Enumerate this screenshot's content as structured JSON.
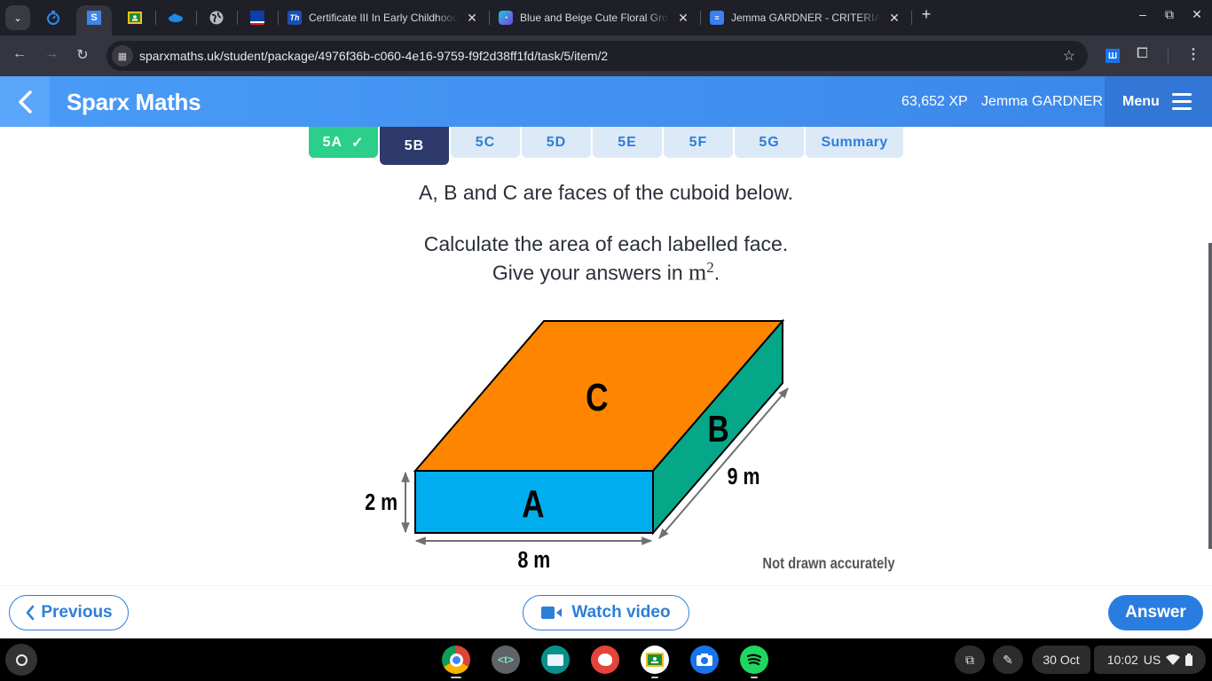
{
  "browser": {
    "tabs": [
      {
        "title": "Certificate III In Early Childhood",
        "favicon": "certificate-favicon",
        "color": "#1a4fb3"
      },
      {
        "title": "Blue and Beige Cute Floral Group",
        "favicon": "canva-favicon",
        "color": "#7b3fe4"
      },
      {
        "title": "Jemma GARDNER - CRITERIA -",
        "favicon": "docs-favicon",
        "color": "#3b7ff0"
      }
    ],
    "pinned_tabs": [
      "timer-icon",
      "sparx-s-icon",
      "classroom-icon",
      "onedrive-icon",
      "globe-icon",
      "flag-icon"
    ],
    "pinned_active_letter": "S",
    "new_tab": "+",
    "url": "sparxmaths.uk/student/package/4976f36b-c060-4e16-9759-f9f2d38ff1fd/task/5/item/2",
    "extension_letter": "Ш"
  },
  "header": {
    "brand": "Sparx Maths",
    "xp": "63,652 XP",
    "user": "Jemma GARDNER",
    "menu_label": "Menu"
  },
  "task_tabs": [
    {
      "label": "5A",
      "state": "done",
      "check": "✓"
    },
    {
      "label": "5B",
      "state": "active"
    },
    {
      "label": "5C",
      "state": "default"
    },
    {
      "label": "5D",
      "state": "default"
    },
    {
      "label": "5E",
      "state": "default"
    },
    {
      "label": "5F",
      "state": "default"
    },
    {
      "label": "5G",
      "state": "default"
    },
    {
      "label": "Summary",
      "state": "default"
    }
  ],
  "question": {
    "line1": "A, B and C are faces of the cuboid below.",
    "line2": "Calculate the area of each labelled face.",
    "line3_prefix": "Give your answers in ",
    "unit": "m",
    "unit_power": "2",
    "line3_suffix": "."
  },
  "diagram": {
    "faces": [
      {
        "label": "A",
        "color": "#00aeef"
      },
      {
        "label": "B",
        "color": "#06a688"
      },
      {
        "label": "C",
        "color": "#fd8500"
      }
    ],
    "dimensions": {
      "height": "2 m",
      "width": "8 m",
      "depth": "9 m"
    },
    "note": "Not drawn accurately"
  },
  "footer": {
    "previous_label": "Previous",
    "watch_video_label": "Watch video",
    "answer_label": "Answer"
  },
  "shelf": {
    "apps": [
      "chrome",
      "text-editor",
      "news-app",
      "paint-app",
      "classroom",
      "camera",
      "spotify"
    ],
    "text_editor_glyph": "<t>",
    "date": "30 Oct",
    "time": "10:02",
    "locale": "US"
  }
}
